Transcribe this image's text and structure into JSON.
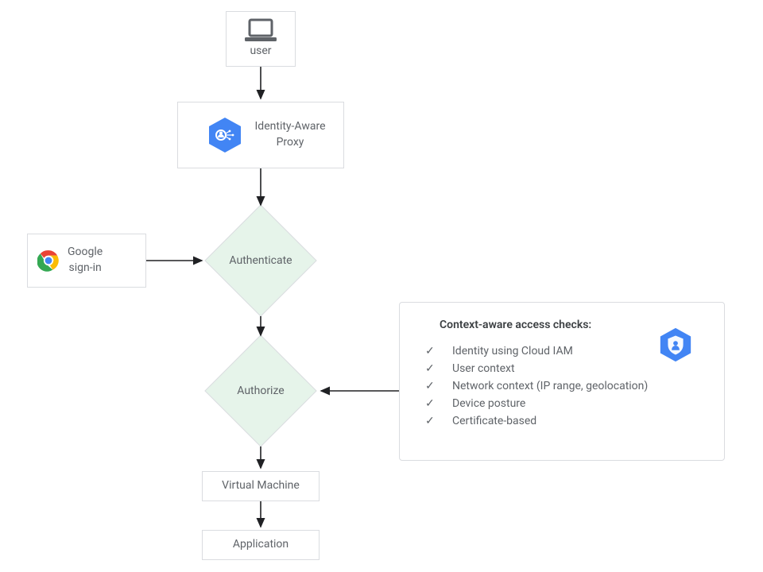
{
  "nodes": {
    "user": "user",
    "iap": "Identity-Aware\nProxy",
    "signin_line1": "Google",
    "signin_line2": "sign-in",
    "authenticate": "Authenticate",
    "authorize": "Authorize",
    "vm": "Virtual Machine",
    "app": "Application"
  },
  "panel": {
    "title": "Context-aware access checks:",
    "items": [
      "Identity using Cloud IAM",
      "User context",
      "Network context (IP range, geolocation)",
      "Device posture",
      "Certificate-based"
    ]
  },
  "icons": {
    "laptop": "laptop-icon",
    "iap_hex": "iap-hex-icon",
    "chrome": "chrome-icon",
    "security_hex": "security-hex-icon"
  },
  "colors": {
    "border": "#dadce0",
    "text": "#5f6368",
    "diamond_fill": "#e6f4ea",
    "hex_blue": "#4285f4"
  }
}
